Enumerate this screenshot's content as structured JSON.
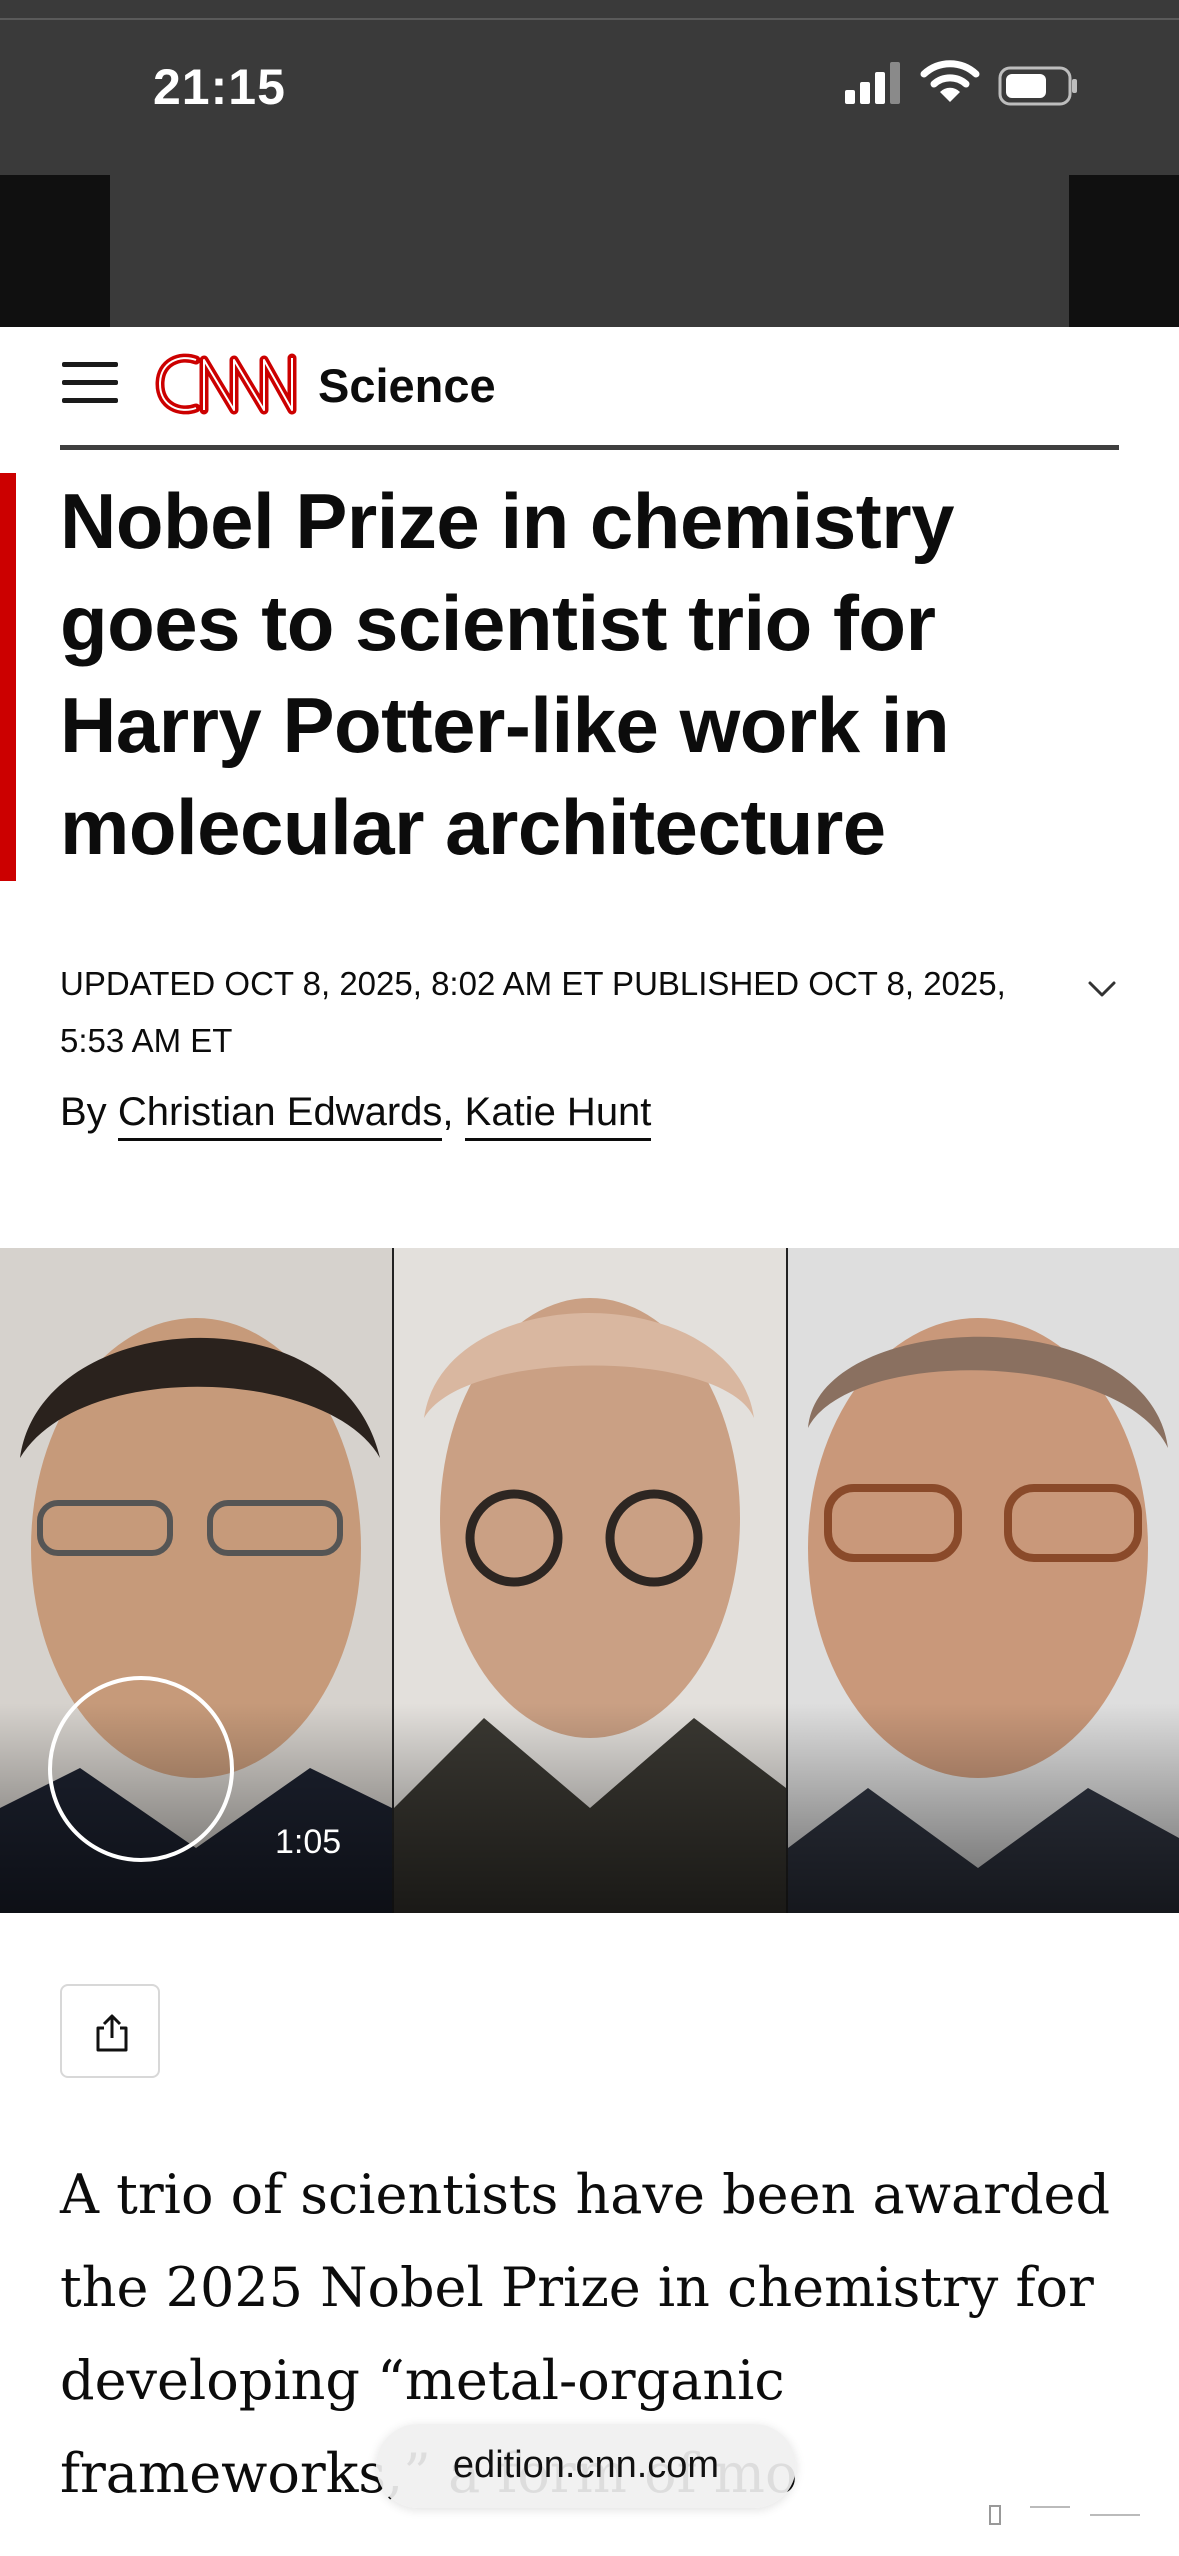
{
  "status_bar": {
    "time": "21:15",
    "icons": [
      "cellular-signal-icon",
      "wifi-icon",
      "battery-icon"
    ]
  },
  "nav": {
    "menu_icon": "hamburger-menu-icon",
    "logo": "CNN",
    "section": "Science",
    "brand_color": "#cc0000"
  },
  "article": {
    "headline": "Nobel Prize in chemistry goes to scientist trio for Harry Potter-like work in molecular architecture",
    "timestamp": "UPDATED OCT 8, 2025, 8:02 AM ET PUBLISHED OCT 8, 2025, 5:53 AM ET",
    "byline_prefix": "By",
    "authors": [
      "Christian Edwards",
      "Katie Hunt"
    ],
    "author_separator": ",",
    "video": {
      "duration": "1:05",
      "icon": "play-icon"
    },
    "share_icon": "share-icon",
    "body_text": "A trio of scientists have been awarded the 2025 Nobel Prize in chemistry for developing “metal-organic frameworks,” a form of mo"
  },
  "browser": {
    "url": "edition.cnn.com"
  }
}
